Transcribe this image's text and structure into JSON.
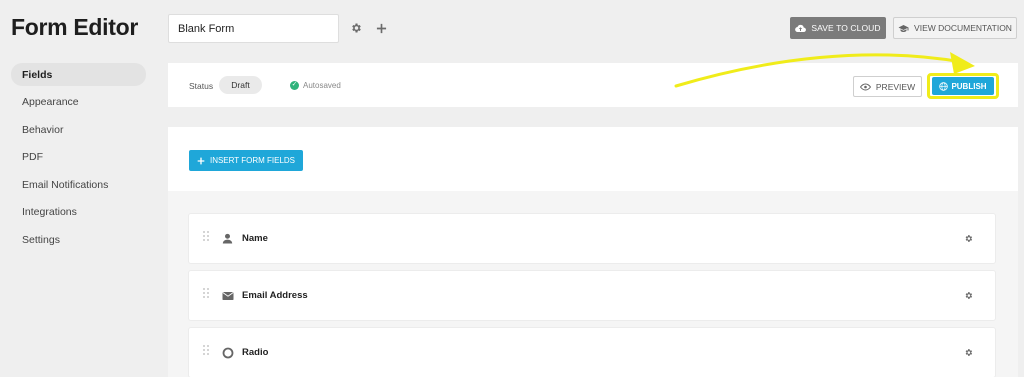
{
  "header": {
    "app_title": "Form Editor",
    "form_name": "Blank Form",
    "save_cloud_label": "SAVE TO CLOUD",
    "view_docs_label": "VIEW DOCUMENTATION"
  },
  "sidebar": {
    "items": [
      {
        "label": "Fields",
        "active": true
      },
      {
        "label": "Appearance"
      },
      {
        "label": "Behavior"
      },
      {
        "label": "PDF"
      },
      {
        "label": "Email Notifications"
      },
      {
        "label": "Integrations"
      },
      {
        "label": "Settings"
      }
    ]
  },
  "status": {
    "label": "Status",
    "badge": "Draft",
    "autosaved": "Autosaved",
    "preview_label": "PREVIEW",
    "publish_label": "PUBLISH"
  },
  "insert": {
    "button_label": "INSERT FORM FIELDS"
  },
  "fields": [
    {
      "label": "Name",
      "icon": "person-icon"
    },
    {
      "label": "Email Address",
      "icon": "envelope-icon"
    },
    {
      "label": "Radio",
      "icon": "radio-icon"
    }
  ],
  "colors": {
    "accent": "#1fa7d9",
    "highlight": "#f0ec1a",
    "success": "#2fb37b"
  }
}
